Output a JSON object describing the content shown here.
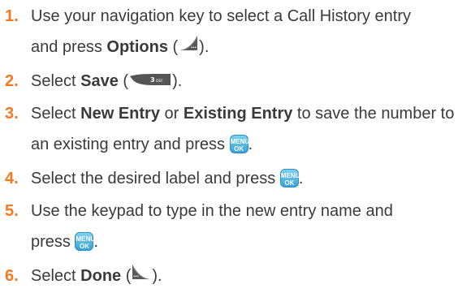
{
  "steps": [
    {
      "number": "1.",
      "line1_a": "Use your navigation key to select a Call History entry",
      "line2_a": "and press ",
      "bold": "Options",
      "paren_open": " (",
      "paren_close": ")."
    },
    {
      "number": "2.",
      "a": "Select ",
      "bold": "Save",
      "paren_open": " (",
      "paren_close": ")."
    },
    {
      "number": "3.",
      "a": "Select ",
      "bold1": "New Entry",
      "mid": " or ",
      "bold2": "Existing Entry",
      "b": " to save the number to",
      "line2_a": "an existing entry and press ",
      "end": "."
    },
    {
      "number": "4.",
      "a": "Select the desired label and press ",
      "end": "."
    },
    {
      "number": "5.",
      "a": "Use the keypad to type in the new entry name and",
      "line2_a": "press ",
      "end": "."
    },
    {
      "number": "6.",
      "a": "Select ",
      "bold": "Done",
      "paren_open": " (",
      "paren_close": ")."
    }
  ],
  "keys": {
    "ok_top": "MENU",
    "ok_bottom": "OK",
    "three_digit": "3",
    "three_letters": "DEF"
  },
  "colors": {
    "number": "#f47920",
    "text": "#3a3a3a",
    "ok_key": "#36a3d6",
    "soft_key": "#555555"
  }
}
